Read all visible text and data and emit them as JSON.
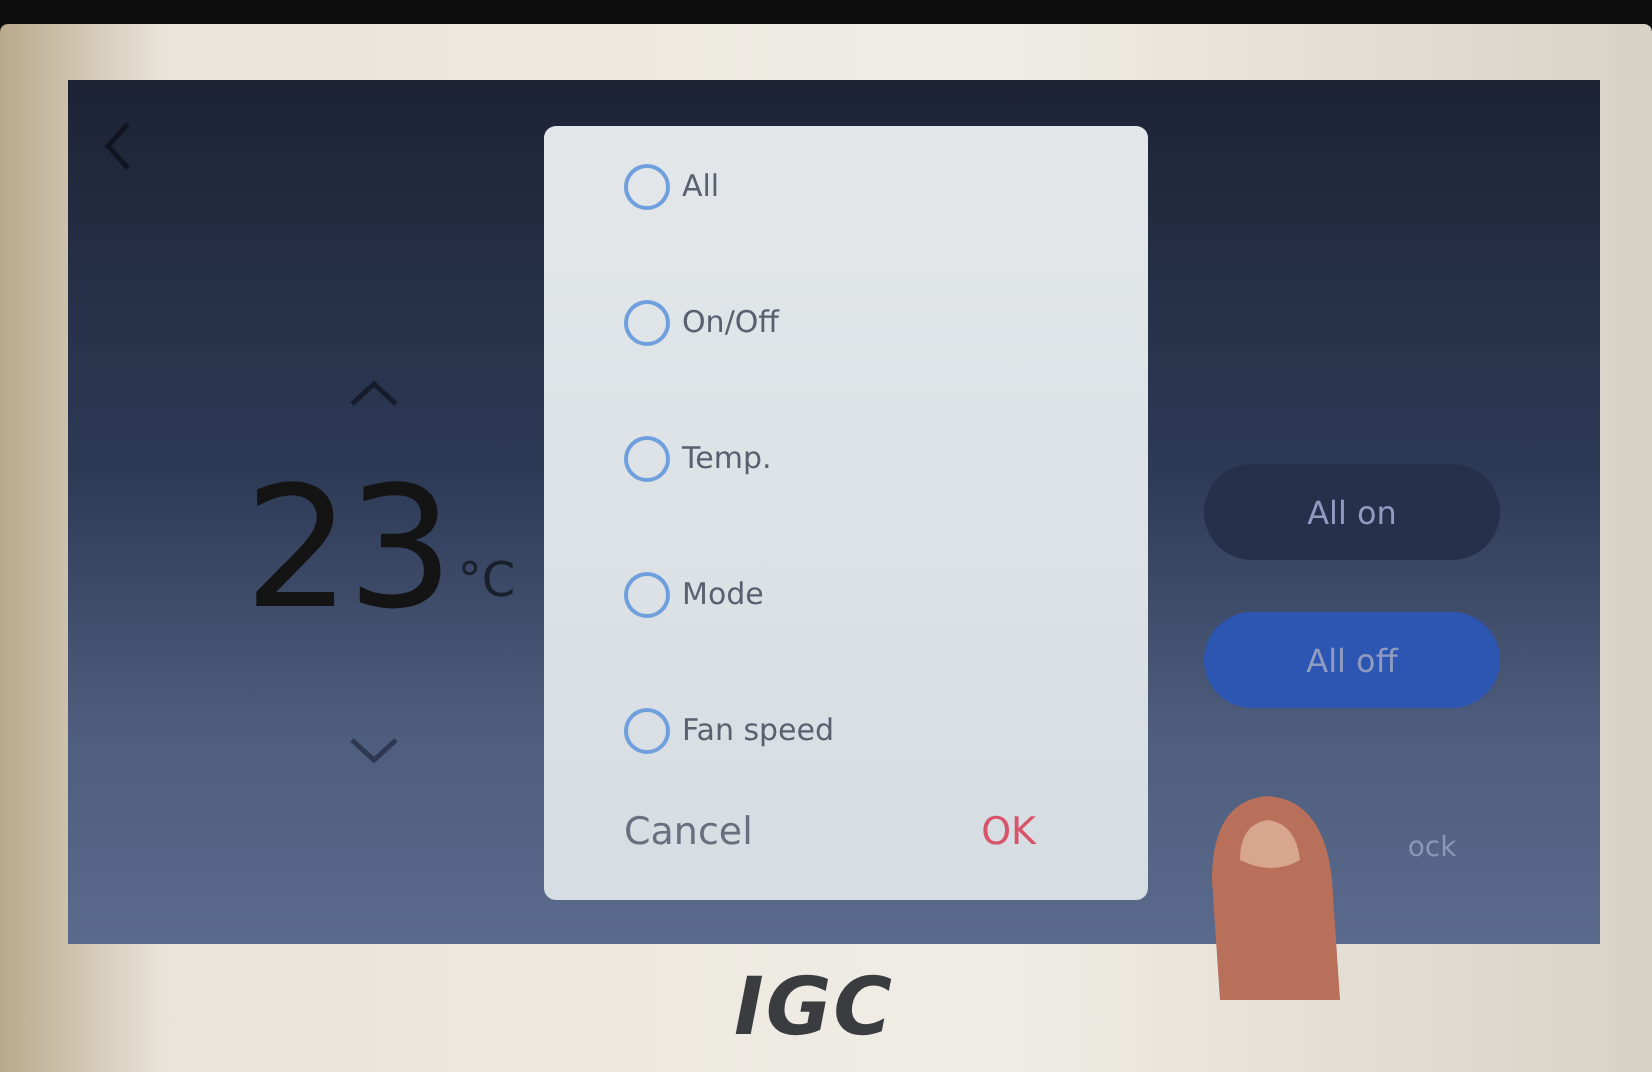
{
  "temperature": {
    "value": "23",
    "unit": "°C"
  },
  "buttons": [
    {
      "label": "All on",
      "kind": "dark"
    },
    {
      "label": "All off",
      "kind": "blue"
    }
  ],
  "lock_label": "ock",
  "dialog": {
    "options": [
      {
        "label": "All",
        "selected": false
      },
      {
        "label": "On/Off",
        "selected": false
      },
      {
        "label": "Temp.",
        "selected": false
      },
      {
        "label": "Mode",
        "selected": false
      },
      {
        "label": "Fan speed",
        "selected": false
      }
    ],
    "cancel": "Cancel",
    "ok": "OK"
  },
  "brand": "IGC"
}
